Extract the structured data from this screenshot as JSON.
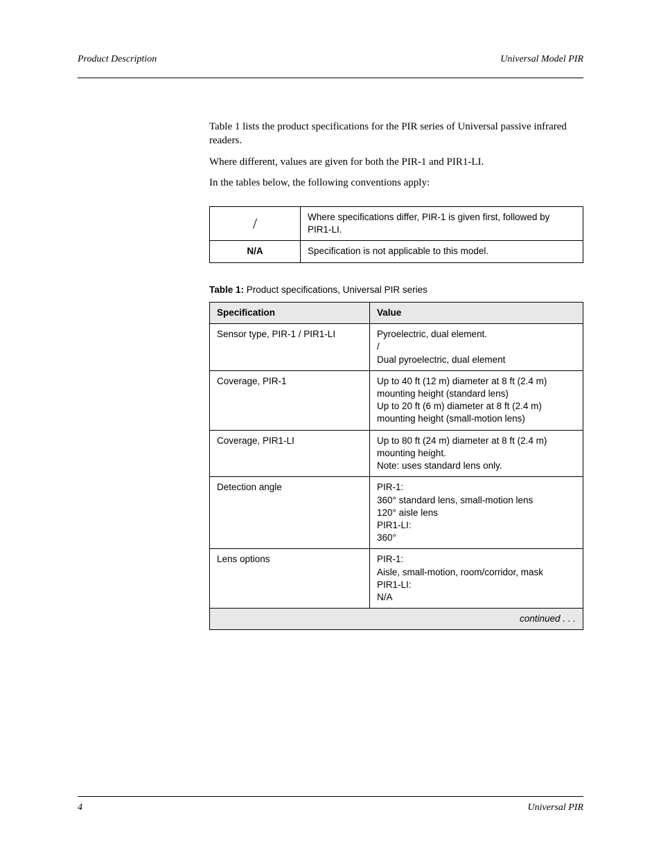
{
  "header": {
    "left": "Product Description",
    "right": "Universal Model PIR"
  },
  "intro": {
    "p1": "Table 1 lists the product specifications for the PIR series of Universal passive infrared readers.",
    "p2": "Where different, values are given for both the PIR-1 and PIR1-LI.",
    "p3": "In the tables below, the following conventions apply:"
  },
  "sig_table": {
    "rows": [
      {
        "symbol": "/",
        "text": "Where specifications differ, PIR-1 is given first, followed by PIR1-LI."
      },
      {
        "symbol": "N/A",
        "text": "Specification is not applicable to this model."
      }
    ]
  },
  "table1": {
    "caption_bold": "Table 1: ",
    "caption_rest": "Product specifications, Universal PIR series",
    "head": {
      "col1": "Specification",
      "col2": "Value"
    },
    "rows": [
      {
        "col1": "Sensor type, PIR-1 / PIR1-LI",
        "col2": "Pyroelectric, dual element.\n/\nDual pyroelectric, dual element"
      },
      {
        "col1": "Coverage, PIR-1",
        "col2": "Up to 40 ft (12 m) diameter at 8 ft (2.4 m) mounting height (standard lens)\nUp to 20 ft (6 m) diameter at 8 ft (2.4 m) mounting height (small-motion lens)"
      },
      {
        "col1": "Coverage, PIR1-LI",
        "col2": "Up to 80 ft (24 m) diameter at 8 ft (2.4 m) mounting height.\nNote: uses standard lens only."
      },
      {
        "col1": "Detection angle",
        "col2": "PIR-1:\n360° standard lens, small-motion lens\n120° aisle lens\nPIR1-LI:\n360°"
      },
      {
        "col1": "Lens options",
        "col2": "PIR-1:\nAisle, small-motion, room/corridor, mask\nPIR1-LI:\nN/A"
      }
    ],
    "footer": "continued . . ."
  },
  "footer": {
    "left": "4",
    "right": "Universal PIR"
  }
}
